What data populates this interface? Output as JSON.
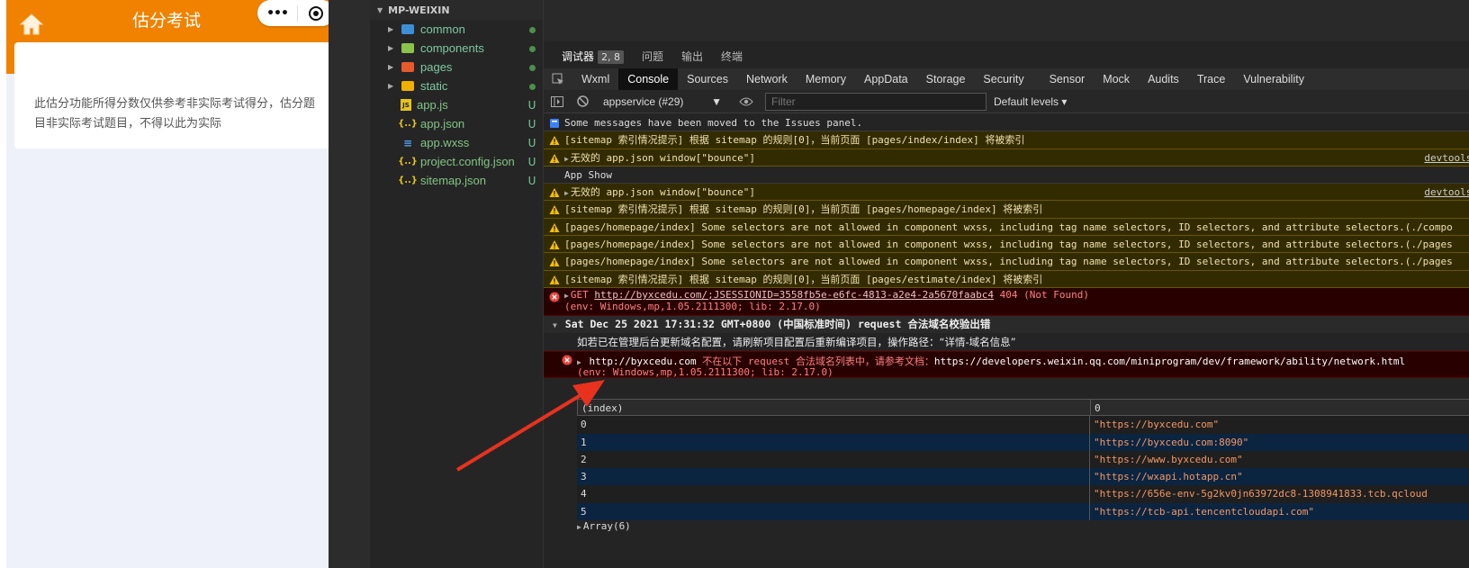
{
  "simulator": {
    "title": "估分考试",
    "capsule_dots": "•••",
    "notice": "此估分功能所得分数仅供参考非实际考试得分，估分题目非实际考试题目，不得以此为实际"
  },
  "explorer": {
    "header": "MP-WEIXIN",
    "items": [
      {
        "label": "common",
        "type": "folder",
        "color": "#3c8ed6",
        "status": "●"
      },
      {
        "label": "components",
        "type": "folder",
        "color": "#8bc34a",
        "status": "●"
      },
      {
        "label": "pages",
        "type": "folder",
        "color": "#e65a2c",
        "status": "●"
      },
      {
        "label": "static",
        "type": "folder",
        "color": "#f0b000",
        "status": "●"
      },
      {
        "label": "app.js",
        "type": "js",
        "color": "#e8c31a",
        "status": "U"
      },
      {
        "label": "app.json",
        "type": "json",
        "color": "#e8c31a",
        "status": "U"
      },
      {
        "label": "app.wxss",
        "type": "css",
        "color": "#4fa0f0",
        "status": "U"
      },
      {
        "label": "project.config.json",
        "type": "json",
        "color": "#e8c31a",
        "status": "U"
      },
      {
        "label": "sitemap.json",
        "type": "json",
        "color": "#e8c31a",
        "status": "U"
      }
    ]
  },
  "devtools": {
    "top_tabs": [
      {
        "label": "调试器",
        "badge": "2, 8",
        "active": true
      },
      {
        "label": "问题"
      },
      {
        "label": "输出"
      },
      {
        "label": "终端"
      }
    ],
    "panels": [
      "Wxml",
      "Console",
      "Sources",
      "Network",
      "Memory",
      "AppData",
      "Storage",
      "Security",
      "Sensor",
      "Mock",
      "Audits",
      "Trace",
      "Vulnerability"
    ],
    "active_panel": "Console",
    "context": "appservice (#29)",
    "filter_placeholder": "Filter",
    "levels": "Default levels ▾"
  },
  "console": {
    "messages": [
      {
        "level": "info",
        "text": "Some messages have been moved to the Issues panel."
      },
      {
        "level": "warn",
        "text": "[sitemap 索引情况提示] 根据 sitemap 的规则[0]，当前页面 [pages/index/index] 将被索引"
      },
      {
        "level": "warn",
        "text": "无效的 app.json window[\"bounce\"]",
        "expand": true,
        "source": "devtools:"
      },
      {
        "level": "log",
        "text": "App Show"
      },
      {
        "level": "warn",
        "text": "无效的 app.json window[\"bounce\"]",
        "expand": true,
        "source": "devtools:"
      },
      {
        "level": "warn",
        "text": "[sitemap 索引情况提示] 根据 sitemap 的规则[0]，当前页面 [pages/homepage/index] 将被索引"
      },
      {
        "level": "warn",
        "text": "[pages/homepage/index] Some selectors are not allowed in component wxss, including tag name selectors, ID selectors, and attribute selectors.(./compo"
      },
      {
        "level": "warn",
        "text": "[pages/homepage/index] Some selectors are not allowed in component wxss, including tag name selectors, ID selectors, and attribute selectors.(./pages"
      },
      {
        "level": "warn",
        "text": "[pages/homepage/index] Some selectors are not allowed in component wxss, including tag name selectors, ID selectors, and attribute selectors.(./pages"
      },
      {
        "level": "warn",
        "text": "[sitemap 索引情况提示] 根据 sitemap 的规则[0]，当前页面 [pages/estimate/index] 将被索引"
      }
    ],
    "get_error": {
      "method": "GET",
      "url": "http://byxcedu.com/;JSESSIONID=3558fb5e-e6fc-4813-a2e4-2a5670faabc4",
      "status": "404 (Not Found)",
      "env": "(env: Windows,mp,1.05.2111300; lib: 2.17.0)"
    },
    "group": {
      "title": "Sat Dec 25 2021 17:31:32 GMT+0800 (中国标准时间) request 合法域名校验出错",
      "hint": "如若已在管理后台更新域名配置，请刷新项目配置后重新编译项目，操作路径：“详情-域名信息”",
      "error_url": "http://byxcedu.com",
      "error_msg": "不在以下 request 合法域名列表中，请参考文档：",
      "doc_url": "https://developers.weixin.qq.com/miniprogram/dev/framework/ability/network.html",
      "env": "(env: Windows,mp,1.05.2111300; lib: 2.17.0)"
    },
    "table": {
      "headers": [
        "(index)",
        "0"
      ],
      "rows": [
        [
          "0",
          "\"https://byxcedu.com\""
        ],
        [
          "1",
          "\"https://byxcedu.com:8090\""
        ],
        [
          "2",
          "\"https://www.byxcedu.com\""
        ],
        [
          "3",
          "\"https://wxapi.hotapp.cn\""
        ],
        [
          "4",
          "\"https://656e-env-5g2kv0jn63972dc8-1308941833.tcb.qcloud"
        ],
        [
          "5",
          "\"https://tcb-api.tencentcloudapi.com\""
        ]
      ],
      "footer": "Array(6)"
    }
  },
  "colors": {
    "accent": "#f08200",
    "warn_bg": "#332b00",
    "error_bg": "#290000",
    "annotation_arrow": "#e8321e"
  }
}
